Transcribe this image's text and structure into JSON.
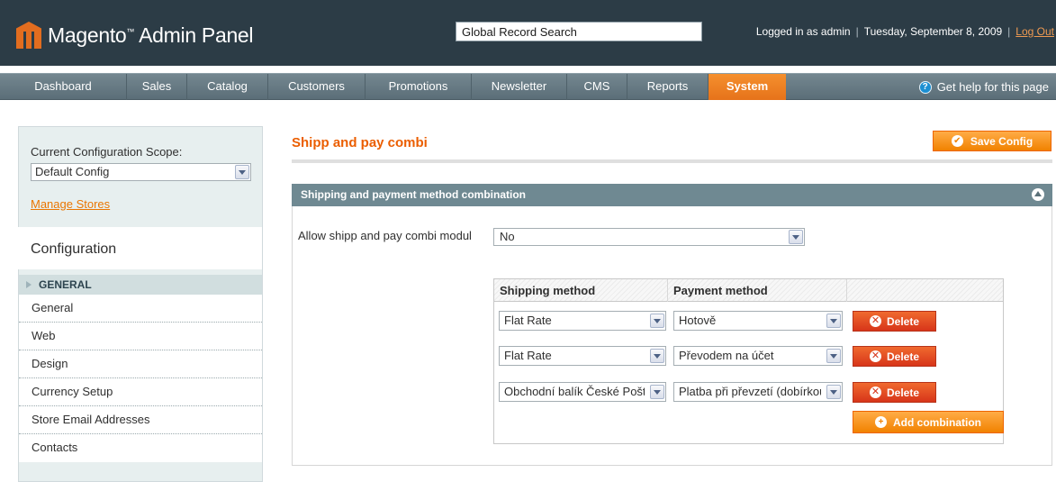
{
  "header": {
    "logo_text": "Magento",
    "logo_tm": "™",
    "logo_suffix": "Admin Panel",
    "search_placeholder": "Global Record Search",
    "logged_in": "Logged in as admin",
    "date": "Tuesday, September 8, 2009",
    "logout": "Log Out",
    "separator": "|"
  },
  "nav": {
    "items": [
      {
        "label": "Dashboard"
      },
      {
        "label": "Sales"
      },
      {
        "label": "Catalog"
      },
      {
        "label": "Customers"
      },
      {
        "label": "Promotions"
      },
      {
        "label": "Newsletter"
      },
      {
        "label": "CMS"
      },
      {
        "label": "Reports"
      },
      {
        "label": "System"
      }
    ],
    "active": "System",
    "help": "Get help for this page",
    "help_glyph": "?"
  },
  "sidebar": {
    "scope_label": "Current Configuration Scope:",
    "scope_value": "Default Config",
    "manage_stores": "Manage Stores",
    "config_title": "Configuration",
    "group": "GENERAL",
    "items": [
      {
        "label": "General"
      },
      {
        "label": "Web"
      },
      {
        "label": "Design"
      },
      {
        "label": "Currency Setup"
      },
      {
        "label": "Store Email Addresses"
      },
      {
        "label": "Contacts"
      }
    ]
  },
  "main": {
    "title": "Shipp and pay combi",
    "save_button": "Save Config",
    "save_glyph": "✔",
    "section_title": "Shipping and payment method combination",
    "allow_label": "Allow shipp and pay combi modul",
    "allow_value": "No",
    "grid": {
      "col_shipping": "Shipping method",
      "col_payment": "Payment method",
      "rows": [
        {
          "shipping": "Flat Rate",
          "payment": "Hotově"
        },
        {
          "shipping": "Flat Rate",
          "payment": "Převodem na účet"
        },
        {
          "shipping": "Obchodní balík České Pošty",
          "payment": "Platba při převzetí (dobírkou)"
        }
      ],
      "delete_label": "Delete",
      "delete_glyph": "✕",
      "add_label": "Add combination",
      "add_glyph": "+"
    }
  },
  "colors": {
    "header_bg": "#2c3c46",
    "accent_orange": "#eb5e00",
    "nav_active": "#f18200",
    "section_head": "#6f8992",
    "delete_red": "#d7351a"
  }
}
